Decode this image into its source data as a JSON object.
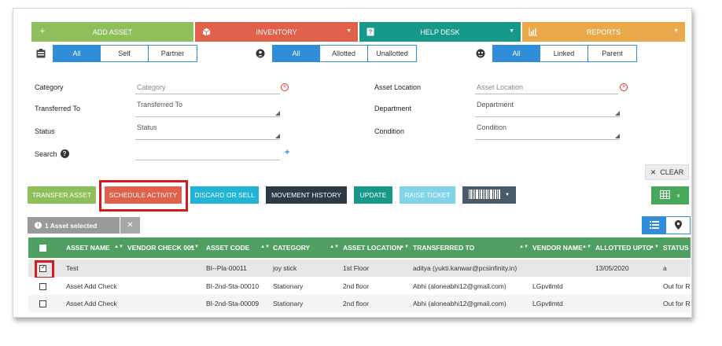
{
  "topnav": [
    {
      "label": "ADD ASSET",
      "icon": "plus-icon",
      "color": "#8fbf5a"
    },
    {
      "label": "INVENTORY",
      "icon": "box-icon",
      "color": "#e0604a"
    },
    {
      "label": "HELP DESK",
      "icon": "help-icon",
      "color": "#17998a"
    },
    {
      "label": "REPORTS",
      "icon": "bar-chart-icon",
      "color": "#e9a94a"
    }
  ],
  "filters": {
    "group1": {
      "icon": "id-card-icon",
      "options": [
        "All",
        "Self",
        "Partner"
      ],
      "active": "All"
    },
    "group2": {
      "icon": "allot-icon",
      "options": [
        "All",
        "Allotted",
        "Unallotted"
      ],
      "active": "All"
    },
    "group3": {
      "icon": "link-icon",
      "options": [
        "All",
        "Linked",
        "Parent"
      ],
      "active": "All"
    }
  },
  "form": {
    "category_label": "Category",
    "category_placeholder": "Category",
    "transferred_label": "Transferred To",
    "transferred_value": "Transferred To",
    "status_label": "Status",
    "status_value": "Status",
    "search_label": "Search",
    "location_label": "Asset Location",
    "location_placeholder": "Asset Location",
    "department_label": "Department",
    "department_value": "Department",
    "condition_label": "Condition",
    "condition_value": "Condition"
  },
  "clear_label": "CLEAR",
  "actions": {
    "transfer": "TRANSFER ASSET",
    "schedule": "SCHEDULE ACTIVITY",
    "discard": "DISCARD OR SELL",
    "movement": "MOVEMENT HISTORY",
    "update": "UPDATE",
    "raise": "RAISE TICKET"
  },
  "selected_label": "1 Asset selected",
  "table": {
    "columns": [
      "ASSET NAME",
      "VENDOR CHECK 001",
      "ASSET CODE",
      "CATEGORY",
      "ASSET LOCATION",
      "TRANSFERRED TO",
      "VENDOR NAME",
      "ALLOTTED UPTO",
      "STATUS"
    ],
    "rows": [
      {
        "checked": true,
        "cells": [
          "Test",
          "",
          "BI--Pla-00011",
          "joy stick",
          "1st Floor",
          "aditya (yukti.kanwar@pcsinfinity.in)",
          "",
          "13/05/2020",
          "a"
        ]
      },
      {
        "checked": false,
        "cells": [
          "Asset Add Check",
          "",
          "BI-2nd-Sta-00010",
          "Stationary",
          "2nd floor",
          "Abhi (aloneabhi12@gmail.com)",
          "LGpvtlmtd",
          "",
          "Out for R"
        ]
      },
      {
        "checked": false,
        "cells": [
          "Asset Add Check",
          "",
          "BI-2nd-Sta-00009",
          "Stationary",
          "2nd floor",
          "Abhi (aloneabhi12@gmail.com)",
          "LGpvtlmtd",
          "",
          "Out for R"
        ]
      }
    ]
  },
  "colors": {
    "accent_blue": "#2f8dd9",
    "header_green": "#4f9f61",
    "highlight_red": "#d41b1b"
  }
}
